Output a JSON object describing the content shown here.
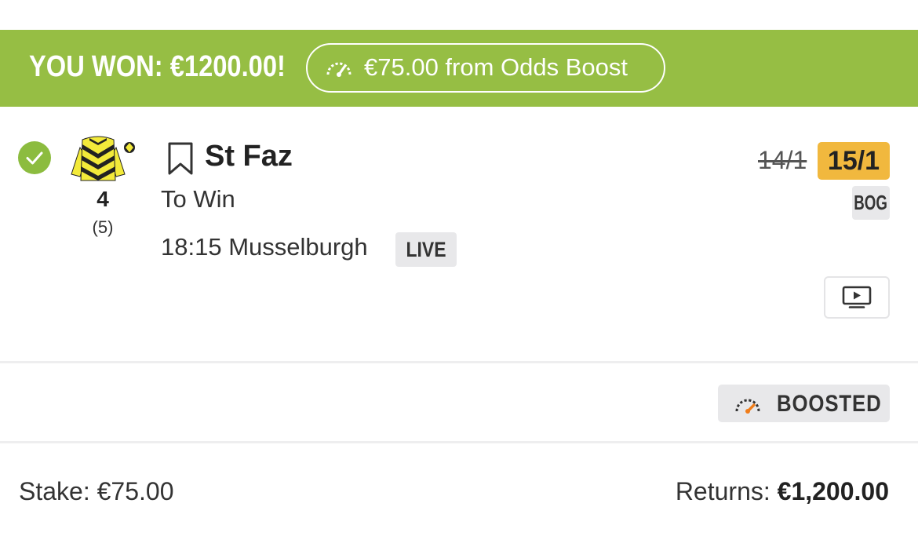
{
  "banner": {
    "won_text": "YOU WON: €1200.00!",
    "boost_text": "€75.00 from Odds Boost",
    "gauge_icon": "speedometer-icon",
    "color": "#96be44"
  },
  "selection": {
    "status_icon": "check-circle-icon",
    "silks_icon": "jockey-silks-icon",
    "cloth_number": "4",
    "draw": "(5)",
    "bookmark_icon": "bookmark-icon",
    "horse_name": "St Faz",
    "market": "To Win",
    "race": "18:15 Musselburgh",
    "live_label": "LIVE",
    "old_odds": "14/1",
    "new_odds": "15/1",
    "bog_label": "BOG",
    "stream_icon": "tv-play-icon",
    "odds_color": "#f1b83e"
  },
  "boost": {
    "label": "BOOSTED",
    "gauge_icon": "speedometer-icon",
    "accent": "#f07d1a"
  },
  "footer": {
    "stake_label": "Stake:",
    "stake_value": "€75.00",
    "returns_label": "Returns:",
    "returns_value": "€1,200.00"
  }
}
